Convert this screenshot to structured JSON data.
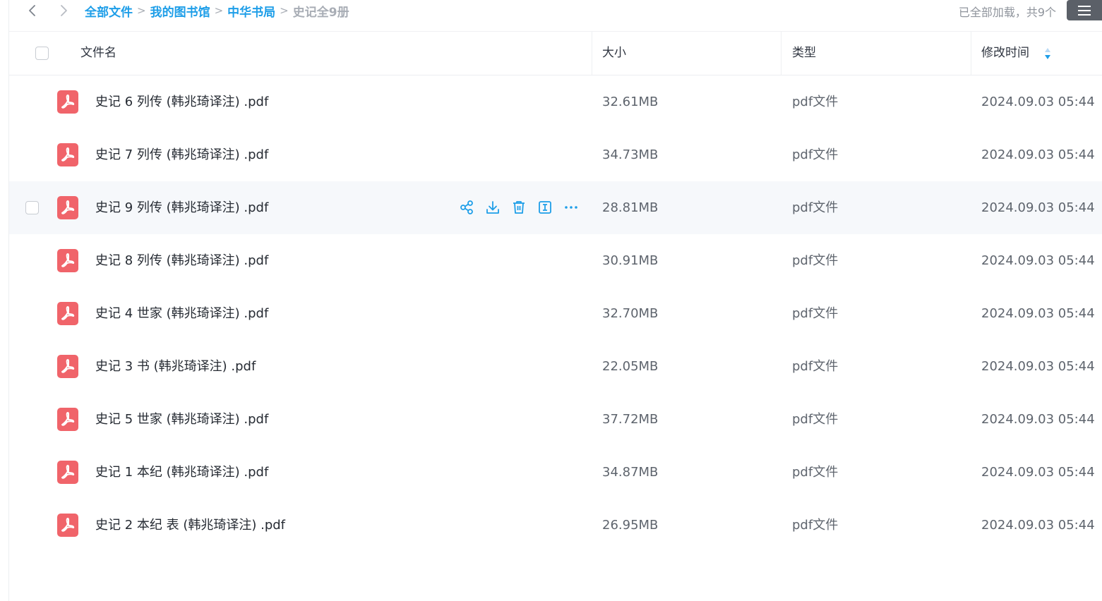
{
  "toolbar": {
    "back_icon": "chevron-left-icon",
    "forward_icon": "chevron-right-icon",
    "breadcrumb": [
      {
        "label": "全部文件"
      },
      {
        "label": "我的图书馆"
      },
      {
        "label": "中华书局"
      },
      {
        "label": "史记全9册"
      }
    ],
    "load_status": "已全部加载，共9个",
    "menu_icon": "hamburger-menu-icon"
  },
  "table": {
    "columns": {
      "name": "文件名",
      "size": "大小",
      "type": "类型",
      "modified": "修改时间"
    },
    "sort_icon": "sort-arrows-icon",
    "row_actions": [
      "share-icon",
      "download-icon",
      "delete-icon",
      "rename-icon",
      "more-icon"
    ],
    "rows": [
      {
        "name": "史记 6 列传 (韩兆琦译注) .pdf",
        "size": "32.61MB",
        "type": "pdf文件",
        "modified": "2024.09.03 05:44",
        "hovered": false
      },
      {
        "name": "史记 7 列传 (韩兆琦译注) .pdf",
        "size": "34.73MB",
        "type": "pdf文件",
        "modified": "2024.09.03 05:44",
        "hovered": false
      },
      {
        "name": "史记 9 列传 (韩兆琦译注) .pdf",
        "size": "28.81MB",
        "type": "pdf文件",
        "modified": "2024.09.03 05:44",
        "hovered": true
      },
      {
        "name": "史记 8 列传 (韩兆琦译注) .pdf",
        "size": "30.91MB",
        "type": "pdf文件",
        "modified": "2024.09.03 05:44",
        "hovered": false
      },
      {
        "name": "史记 4 世家 (韩兆琦译注) .pdf",
        "size": "32.70MB",
        "type": "pdf文件",
        "modified": "2024.09.03 05:44",
        "hovered": false
      },
      {
        "name": "史记 3 书 (韩兆琦译注) .pdf",
        "size": "22.05MB",
        "type": "pdf文件",
        "modified": "2024.09.03 05:44",
        "hovered": false
      },
      {
        "name": "史记 5 世家 (韩兆琦译注) .pdf",
        "size": "37.72MB",
        "type": "pdf文件",
        "modified": "2024.09.03 05:44",
        "hovered": false
      },
      {
        "name": "史记 1 本纪 (韩兆琦译注) .pdf",
        "size": "34.87MB",
        "type": "pdf文件",
        "modified": "2024.09.03 05:44",
        "hovered": false
      },
      {
        "name": "史记 2 本纪 表 (韩兆琦译注) .pdf",
        "size": "26.95MB",
        "type": "pdf文件",
        "modified": "2024.09.03 05:44",
        "hovered": false
      }
    ]
  },
  "colors": {
    "accent": "#1e9ee8",
    "pdf_icon": "#f0646a",
    "hover_row": "#f6f8fb",
    "menu_button": "#5b6068"
  }
}
